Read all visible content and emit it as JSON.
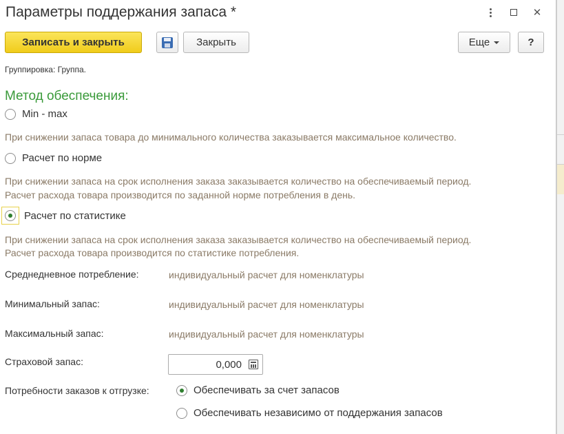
{
  "window": {
    "title": "Параметры поддержания запаса *"
  },
  "toolbar": {
    "save_close_label": "Записать и закрыть",
    "close_label": "Закрыть",
    "more_label": "Еще",
    "help_label": "?"
  },
  "grouping_note": "Группировка: Группа.",
  "supply_method": {
    "title": "Метод обеспечения:",
    "selected": "Расчет по статистике",
    "options": [
      {
        "label": "Min - max",
        "hint_lines": [
          "При снижении запаса товара до минимального количества заказывается максимальное количество."
        ]
      },
      {
        "label": "Расчет по норме",
        "hint_lines": [
          "При снижении запаса на срок исполнения заказа заказывается количество на обеспечиваемый период.",
          "Расчет расхода товара производится по заданной норме потребления в день."
        ]
      },
      {
        "label": "Расчет по статистике",
        "hint_lines": [
          "При снижении запаса на срок исполнения заказа заказывается количество на обеспечиваемый период.",
          "Расчет расхода товара производится по статистике потребления."
        ]
      }
    ]
  },
  "fields": {
    "avg_daily": {
      "label": "Среднедневное потребление:",
      "value": "индивидуальный расчет для номенклатуры"
    },
    "min_stock": {
      "label": "Минимальный запас:",
      "value": "индивидуальный расчет для номенклатуры"
    },
    "max_stock": {
      "label": "Максимальный запас:",
      "value": "индивидуальный расчет для номенклатуры"
    },
    "safety_stock": {
      "label": "Страховой запас:",
      "value": "0,000"
    }
  },
  "order_needs": {
    "label": "Потребности заказов к отгрузке:",
    "selected": "Обеспечивать за счет запасов",
    "options": [
      "Обеспечивать за счет запасов",
      "Обеспечивать независимо от поддержания запасов"
    ]
  },
  "colors": {
    "accent_green": "#3a9a3a",
    "primary_button": "#f0cc1b",
    "hint_text": "#8a7a66"
  }
}
